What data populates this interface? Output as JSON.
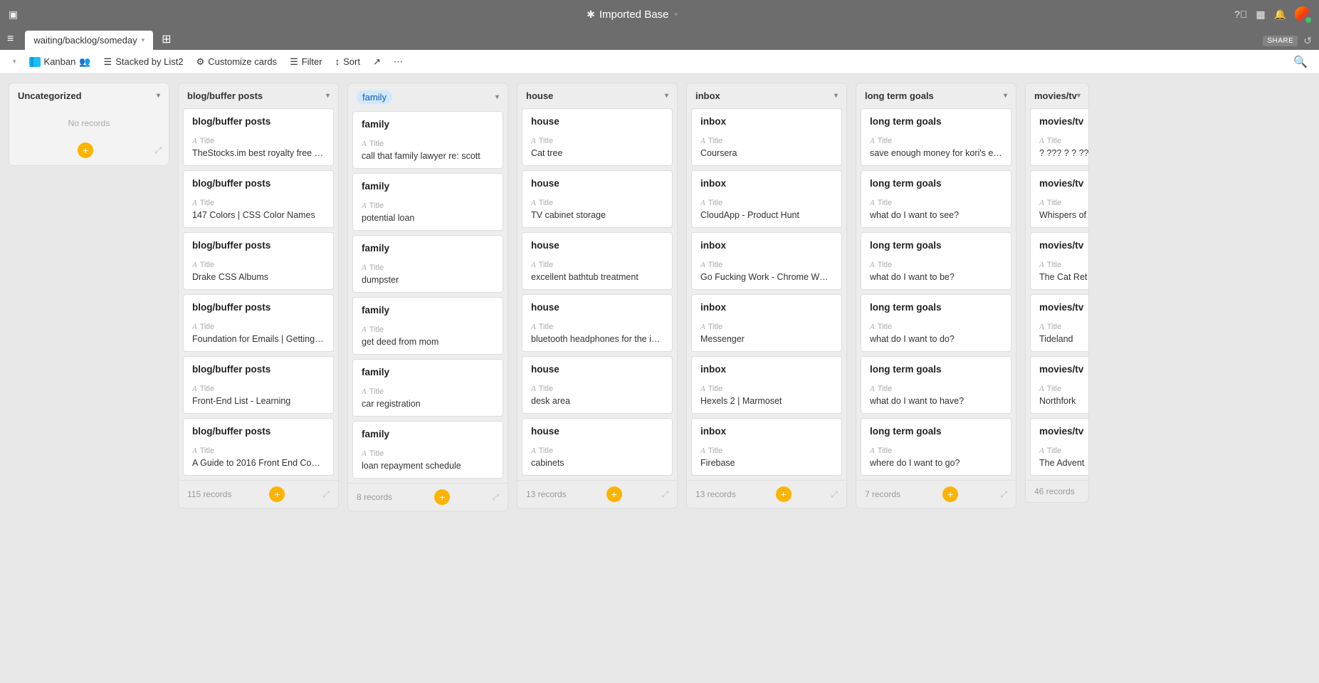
{
  "topbar": {
    "title": "Imported Base"
  },
  "tabbar": {
    "tab_label": "waiting/backlog/someday",
    "share": "SHARE"
  },
  "toolbar": {
    "view": "Kanban",
    "stacked": "Stacked by List2",
    "customize": "Customize cards",
    "filter": "Filter",
    "sort": "Sort"
  },
  "labels": {
    "no_records": "No records",
    "title": "Title",
    "records_suffix": " records"
  },
  "columns": [
    {
      "name": "Uncategorized",
      "pill": false,
      "uncat": true,
      "empty": true,
      "count": null,
      "cards": []
    },
    {
      "name": "blog/buffer posts",
      "pill": false,
      "count": "115",
      "cards": [
        {
          "heading": "blog/buffer posts",
          "title": "TheStocks.im best royalty free stoc..."
        },
        {
          "heading": "blog/buffer posts",
          "title": "147 Colors | CSS Color Names"
        },
        {
          "heading": "blog/buffer posts",
          "title": "Drake CSS Albums"
        },
        {
          "heading": "blog/buffer posts",
          "title": "Foundation for Emails | Getting sta..."
        },
        {
          "heading": "blog/buffer posts",
          "title": "Front-End List - Learning"
        },
        {
          "heading": "blog/buffer posts",
          "title": "A Guide to 2016 Front End Confer..."
        }
      ]
    },
    {
      "name": "family",
      "pill": true,
      "count": "8",
      "cards": [
        {
          "heading": "family",
          "title": "call that family lawyer re: scott"
        },
        {
          "heading": "family",
          "title": "potential loan"
        },
        {
          "heading": "family",
          "title": "dumpster"
        },
        {
          "heading": "family",
          "title": "get deed from mom"
        },
        {
          "heading": "family",
          "title": "car registration"
        },
        {
          "heading": "family",
          "title": "loan repayment schedule"
        }
      ]
    },
    {
      "name": "house",
      "pill": false,
      "count": "13",
      "cards": [
        {
          "heading": "house",
          "title": "Cat tree"
        },
        {
          "heading": "house",
          "title": "TV cabinet storage"
        },
        {
          "heading": "house",
          "title": "excellent bathtub treatment"
        },
        {
          "heading": "house",
          "title": "bluetooth headphones for the ipad"
        },
        {
          "heading": "house",
          "title": "desk area"
        },
        {
          "heading": "house",
          "title": "cabinets"
        }
      ]
    },
    {
      "name": "inbox",
      "pill": false,
      "count": "13",
      "cards": [
        {
          "heading": "inbox",
          "title": "Coursera"
        },
        {
          "heading": "inbox",
          "title": "CloudApp - Product Hunt"
        },
        {
          "heading": "inbox",
          "title": "Go Fucking Work - Chrome Web S..."
        },
        {
          "heading": "inbox",
          "title": "Messenger"
        },
        {
          "heading": "inbox",
          "title": "Hexels 2 | Marmoset"
        },
        {
          "heading": "inbox",
          "title": "Firebase"
        }
      ]
    },
    {
      "name": "long term goals",
      "pill": false,
      "count": "7",
      "cards": [
        {
          "heading": "long term goals",
          "title": "save enough money for kori's edu..."
        },
        {
          "heading": "long term goals",
          "title": "what do I want to see?"
        },
        {
          "heading": "long term goals",
          "title": "what do I want to be?"
        },
        {
          "heading": "long term goals",
          "title": "what do I want to do?"
        },
        {
          "heading": "long term goals",
          "title": "what do I want to have?"
        },
        {
          "heading": "long term goals",
          "title": "where do I want to go?"
        }
      ]
    },
    {
      "name": "movies/tv",
      "pill": false,
      "partial": true,
      "count": "46",
      "cards": [
        {
          "heading": "movies/tv",
          "title": "? ??? ? ? ???"
        },
        {
          "heading": "movies/tv",
          "title": "Whispers of"
        },
        {
          "heading": "movies/tv",
          "title": "The Cat Ret"
        },
        {
          "heading": "movies/tv",
          "title": "Tideland"
        },
        {
          "heading": "movies/tv",
          "title": "Northfork"
        },
        {
          "heading": "movies/tv",
          "title": "The Advent"
        }
      ]
    }
  ]
}
